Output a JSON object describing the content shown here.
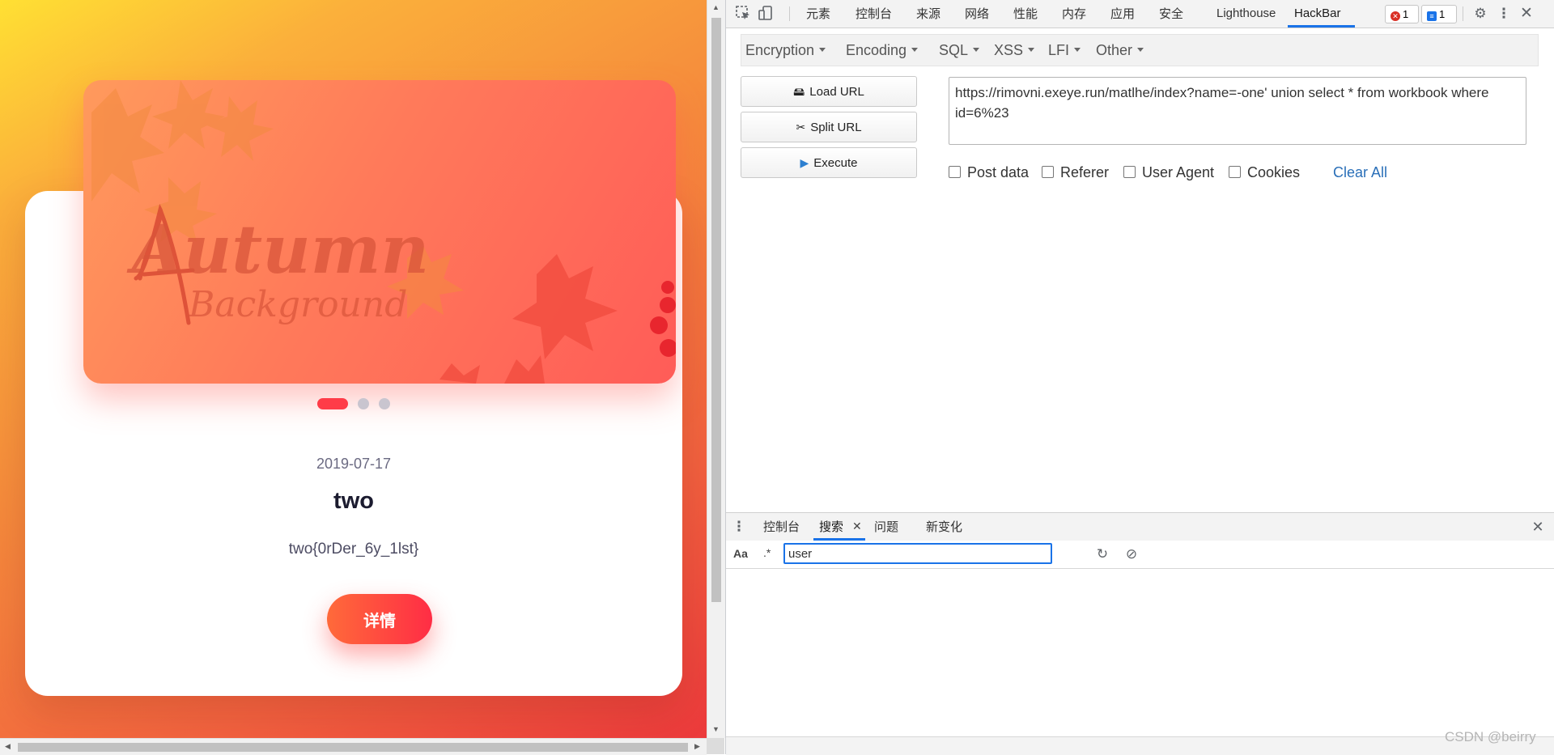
{
  "blog": {
    "date": "2019-07-17",
    "title": "two",
    "text": "two{0rDer_6y_1lst}",
    "details_label": "详情",
    "slide_heading": "Autumn",
    "slide_subheading": "Background"
  },
  "devtools": {
    "tabs": [
      "元素",
      "控制台",
      "来源",
      "网络",
      "性能",
      "内存",
      "应用",
      "安全",
      "Lighthouse",
      "HackBar"
    ],
    "active_tab": "HackBar",
    "error_count": "1",
    "message_count": "1"
  },
  "hackbar": {
    "menu": [
      "Encryption",
      "Encoding",
      "SQL",
      "XSS",
      "LFI",
      "Other"
    ],
    "load_url_label": "Load URL",
    "split_url_label": "Split URL",
    "execute_label": "Execute",
    "url_value": "https://rimovni.exeye.run/matlhe/index?name=-one' union select * from workbook where id=6%23",
    "checkboxes": [
      "Post data",
      "Referer",
      "User Agent",
      "Cookies"
    ],
    "clear_all_label": "Clear All"
  },
  "drawer": {
    "tabs": [
      "控制台",
      "搜索",
      "问题",
      "新变化"
    ],
    "active_tab": "搜索",
    "case_label": "Aa",
    "regex_label": ".*",
    "search_value": "user"
  },
  "watermark": "CSDN @beirry",
  "colors": {
    "accent_blue": "#1a73e8",
    "button_gradient_start": "#ff6a3a",
    "button_gradient_end": "#ff2d45",
    "link_blue": "#2a6fb8"
  }
}
